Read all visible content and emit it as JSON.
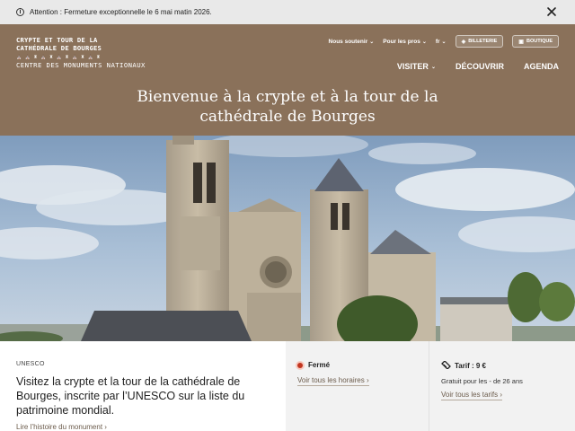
{
  "alert": {
    "text": "Attention : Fermeture exceptionnelle le 6 mai matin 2026."
  },
  "logo": {
    "line1": "CRYPTE ET TOUR DE LA",
    "line2": "CATHÉDRALE DE BOURGES",
    "line3": "CENTRE DES MONUMENTS NATIONAUX"
  },
  "topnav": {
    "support": "Nous soutenir",
    "pros": "Pour les pros",
    "lang": "fr",
    "ticket": "BILLETERIE",
    "shop": "BOUTIQUE"
  },
  "mainnav": {
    "visit": "VISITER",
    "discover": "DÉCOUVRIR",
    "agenda": "AGENDA"
  },
  "page_title": {
    "line1": "Bienvenue à la crypte et à la tour de la",
    "line2": "cathédrale de Bourges"
  },
  "card_intro": {
    "kicker": "UNESCO",
    "text": "Visitez la crypte et la tour de la cathédrale de Bourges, inscrite par l’UNESCO sur la liste du patrimoine mondial.",
    "link": "Lire l’histoire du monument"
  },
  "card_hours": {
    "status": "Fermé",
    "link": "Voir tous les horaires",
    "status_color": "#c2351f"
  },
  "card_price": {
    "title": "Tarif : 9 €",
    "subtitle": "Gratuit pour les - de 26 ans",
    "link": "Voir tous les tarifs"
  },
  "colors": {
    "header_bg": "#8a715a",
    "alert_bg": "#e9e9e9",
    "link": "#6b5b4b"
  },
  "icons": {
    "alert": "info-circle-icon",
    "close": "close-icon",
    "ticket": "ticket-icon",
    "shop": "shopping-bag-icon",
    "price": "ticket-icon",
    "status": "status-dot-icon"
  }
}
